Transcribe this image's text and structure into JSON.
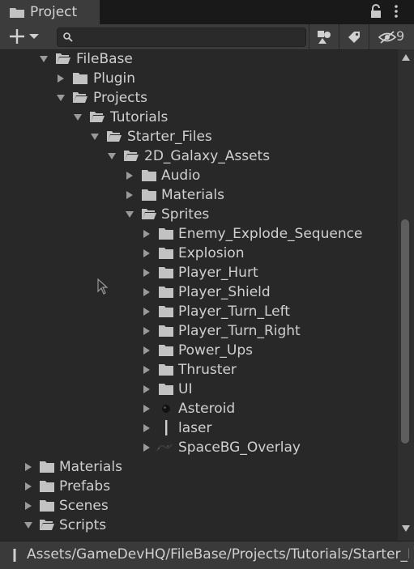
{
  "window": {
    "tab_title": "Project"
  },
  "toolbar": {
    "search_value": "",
    "hidden_count": "9"
  },
  "tree": {
    "filebase": "FileBase",
    "plugin": "Plugin",
    "projects": "Projects",
    "tutorials": "Tutorials",
    "starter_files": "Starter_Files",
    "galaxy_assets": "2D_Galaxy_Assets",
    "audio": "Audio",
    "materials_inner": "Materials",
    "sprites": "Sprites",
    "sprite_items": [
      "Enemy_Explode_Sequence",
      "Explosion",
      "Player_Hurt",
      "Player_Shield",
      "Player_Turn_Left",
      "Player_Turn_Right",
      "Power_Ups",
      "Thruster",
      "UI",
      "Asteroid",
      "laser",
      "SpaceBG_Overlay"
    ],
    "materials": "Materials",
    "prefabs": "Prefabs",
    "scenes": "Scenes",
    "scripts": "Scripts"
  },
  "pathbar": {
    "path": "Assets/GameDevHQ/FileBase/Projects/Tutorials/Starter_Files"
  },
  "icons": {
    "folder": "folder-icon",
    "folder_open": "folder-open-icon",
    "asset_sprite": "sprite-asset-icon"
  },
  "colors": {
    "background": "#282828",
    "folder": "#c2c2c2",
    "text": "#d0d0d0"
  }
}
